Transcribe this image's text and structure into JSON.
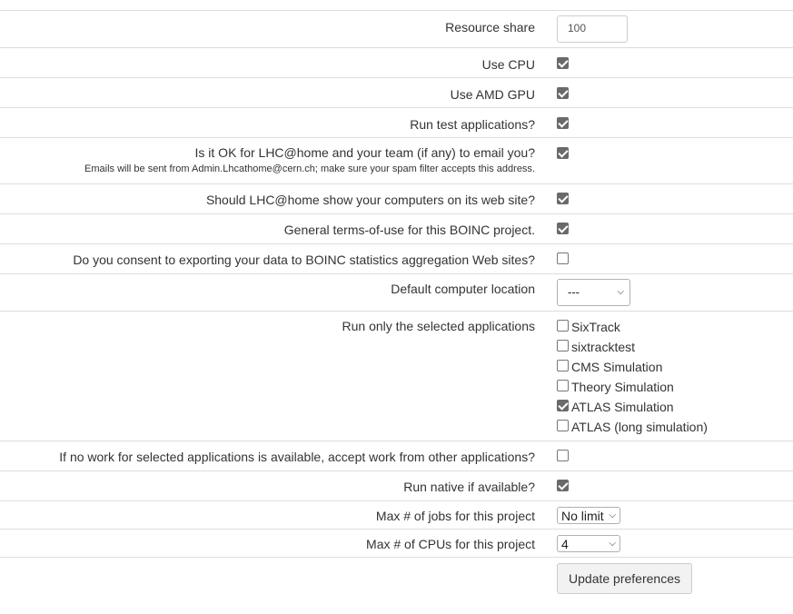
{
  "resource_share": {
    "label": "Resource share",
    "value": "100"
  },
  "use_cpu": {
    "label": "Use CPU",
    "checked": true
  },
  "use_amd_gpu": {
    "label": "Use AMD GPU",
    "checked": true
  },
  "run_test_apps": {
    "label": "Run test applications?",
    "checked": true
  },
  "email_ok": {
    "label": "Is it OK for LHC@home and your team (if any) to email you?",
    "note": "Emails will be sent from Admin.Lhcathome@cern.ch; make sure your spam filter accepts this address.",
    "checked": true
  },
  "show_computers": {
    "label": "Should LHC@home show your computers on its web site?",
    "checked": true
  },
  "terms_of_use": {
    "label": "General terms-of-use for this BOINC project.",
    "checked": true
  },
  "export_consent": {
    "label": "Do you consent to exporting your data to BOINC statistics aggregation Web sites?",
    "checked": false
  },
  "default_location": {
    "label": "Default computer location",
    "selected": "---"
  },
  "run_only_selected": {
    "label": "Run only the selected applications",
    "apps": [
      {
        "name": "SixTrack",
        "checked": false
      },
      {
        "name": "sixtracktest",
        "checked": false
      },
      {
        "name": "CMS Simulation",
        "checked": false
      },
      {
        "name": "Theory Simulation",
        "checked": false
      },
      {
        "name": "ATLAS Simulation",
        "checked": true
      },
      {
        "name": "ATLAS (long simulation)",
        "checked": false
      }
    ]
  },
  "accept_other_work": {
    "label": "If no work for selected applications is available, accept work from other applications?",
    "checked": false
  },
  "run_native": {
    "label": "Run native if available?",
    "checked": true
  },
  "max_jobs": {
    "label": "Max # of jobs for this project",
    "selected": "No limit"
  },
  "max_cpus": {
    "label": "Max # of CPUs for this project",
    "selected": "4"
  },
  "update_button": {
    "label": "Update preferences"
  }
}
